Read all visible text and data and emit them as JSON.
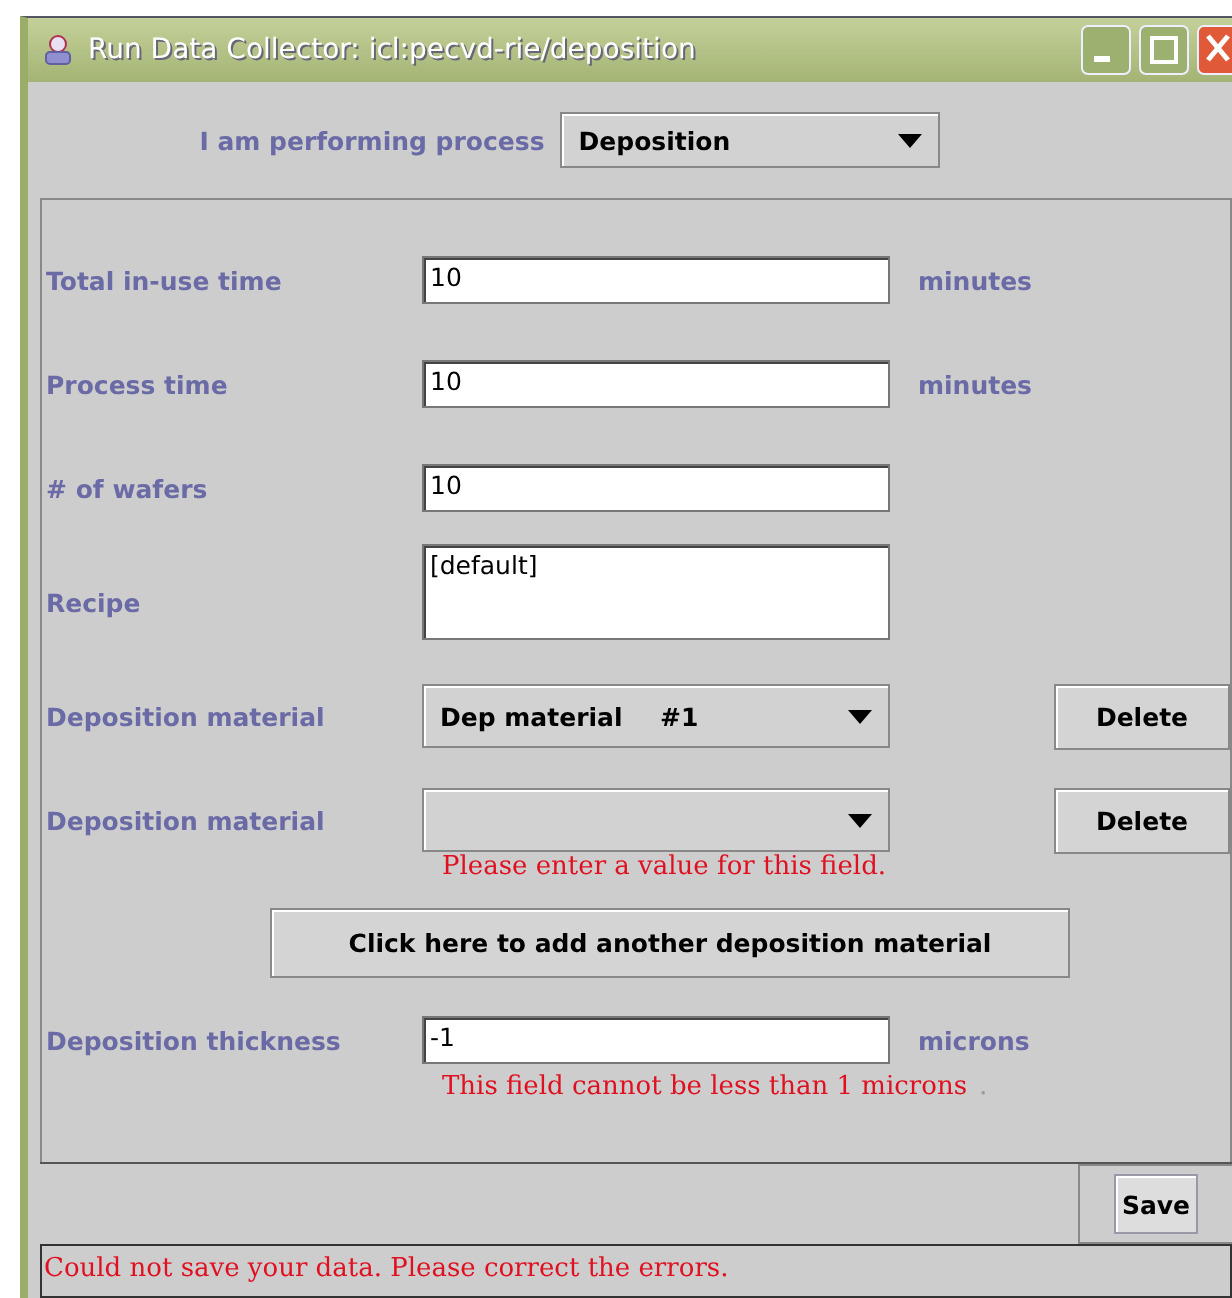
{
  "window": {
    "title": "Run Data Collector: icl:pecvd-rie/deposition"
  },
  "process": {
    "label": "I am performing process",
    "value": "Deposition"
  },
  "rows": [
    {
      "kind": "text",
      "label": "Total in-use time",
      "value": "10",
      "unit": "minutes"
    },
    {
      "kind": "text",
      "label": "Process time",
      "value": "10",
      "unit": "minutes"
    },
    {
      "kind": "text",
      "label": "# of wafers",
      "value": "10"
    },
    {
      "kind": "textarea",
      "label": "Recipe",
      "value": "[default]"
    },
    {
      "kind": "select",
      "label": "Deposition material",
      "value": "Dep material",
      "suffix": "#1",
      "delete": "Delete"
    },
    {
      "kind": "select",
      "label": "Deposition material",
      "delete": "Delete",
      "error": "Please enter a value for this field."
    },
    {
      "kind": "button",
      "label": "Click here to add another deposition material"
    },
    {
      "kind": "text",
      "label": "Deposition thickness",
      "value": "-1",
      "unit": "microns",
      "error": "This field cannot be less than 1 microns",
      "error_tail": "."
    }
  ],
  "save": "Save",
  "status": "Could not save your data. Please correct the errors."
}
